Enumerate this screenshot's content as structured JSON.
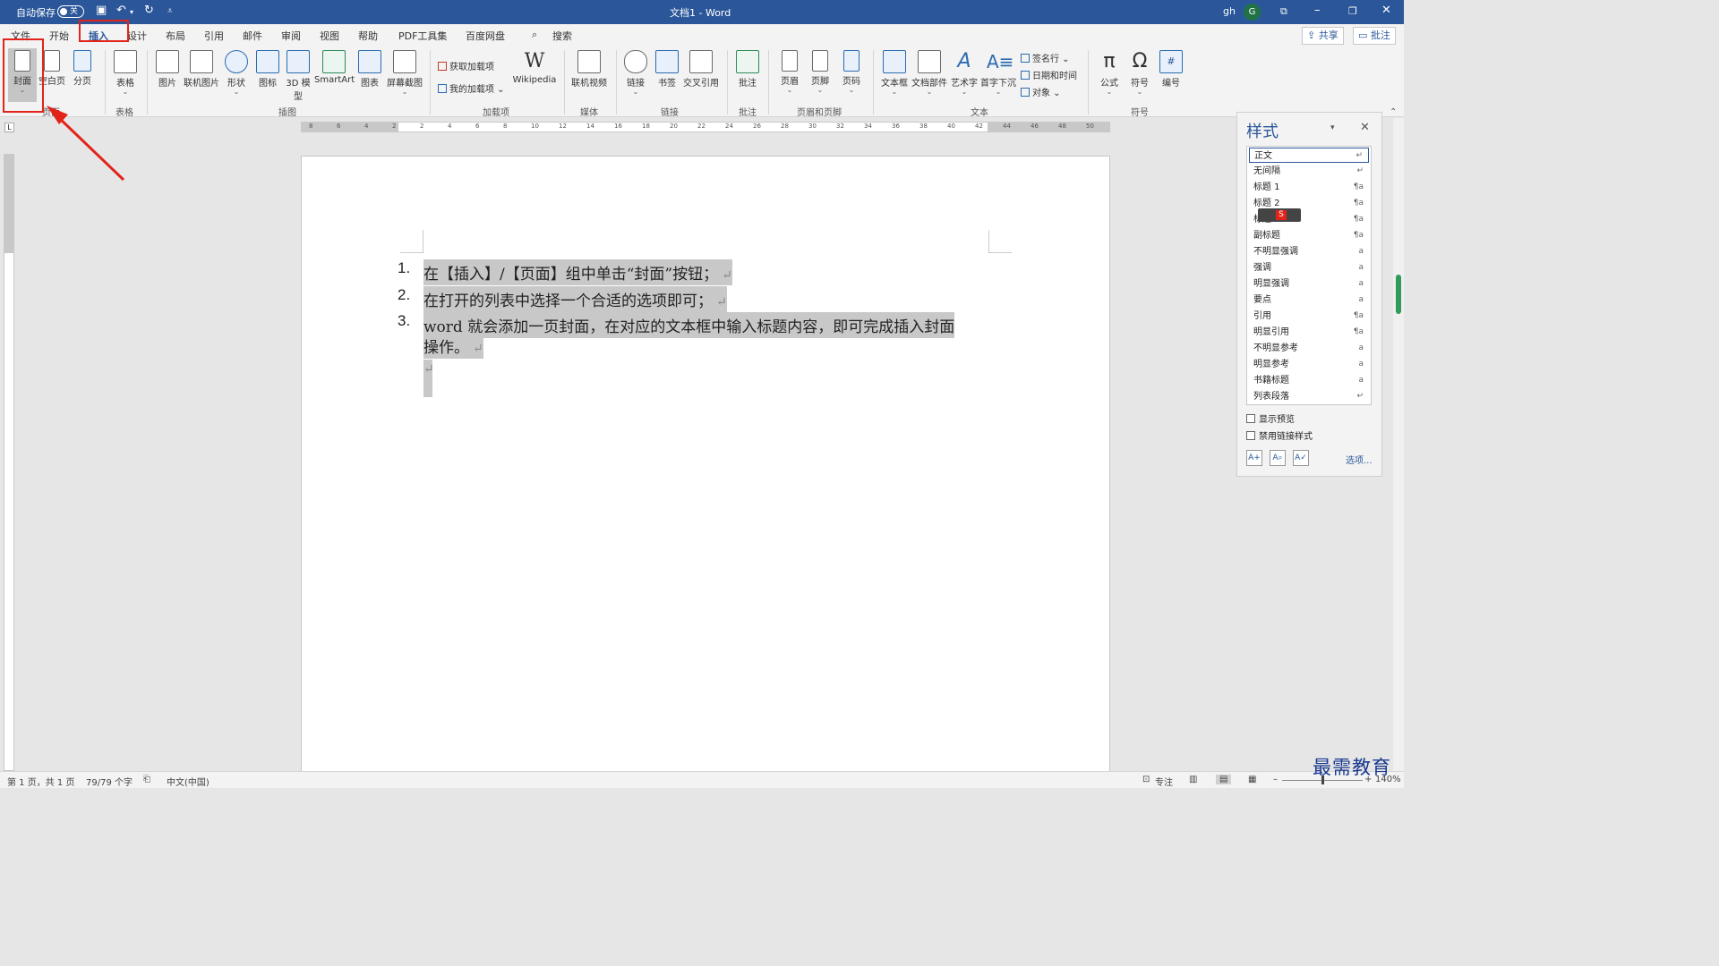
{
  "titlebar": {
    "autosave_label": "自动保存",
    "autosave_state": "关",
    "doc_title": "文档1 - Word",
    "user": "gh",
    "avatar_letter": "G"
  },
  "tabs": [
    "文件",
    "开始",
    "插入",
    "设计",
    "布局",
    "引用",
    "邮件",
    "审阅",
    "视图",
    "帮助",
    "PDF工具集",
    "百度网盘"
  ],
  "active_tab": "插入",
  "search_label": "搜索",
  "share_label": "共享",
  "comment_label": "批注",
  "ribbon": {
    "pages": {
      "group": "页面",
      "buttons": [
        "封面",
        "空白页",
        "分页"
      ]
    },
    "tables": {
      "group": "表格",
      "buttons": [
        "表格"
      ]
    },
    "illustrations": {
      "group": "插图",
      "buttons": [
        "图片",
        "联机图片",
        "形状",
        "图标",
        "3D 模型",
        "SmartArt",
        "图表",
        "屏幕截图"
      ]
    },
    "addins": {
      "group": "加载项",
      "get": "获取加载项",
      "mine": "我的加载项",
      "wiki": "Wikipedia"
    },
    "media": {
      "group": "媒体",
      "buttons": [
        "联机视频"
      ]
    },
    "links": {
      "group": "链接",
      "buttons": [
        "链接",
        "书签",
        "交叉引用"
      ]
    },
    "comments": {
      "group": "批注",
      "buttons": [
        "批注"
      ]
    },
    "header_footer": {
      "group": "页眉和页脚",
      "buttons": [
        "页眉",
        "页脚",
        "页码"
      ]
    },
    "text": {
      "group": "文本",
      "buttons": [
        "文本框",
        "文档部件",
        "艺术字",
        "首字下沉"
      ],
      "small": [
        "签名行",
        "日期和时间",
        "对象"
      ]
    },
    "symbols": {
      "group": "符号",
      "buttons": [
        "公式",
        "符号",
        "编号"
      ]
    }
  },
  "document": {
    "items": [
      {
        "num": "1.",
        "text": "在【插入】/【页面】组中单击“封面”按钮；"
      },
      {
        "num": "2.",
        "text": "在打开的列表中选择一个合适的选项即可；"
      },
      {
        "num": "3.",
        "text": "word 就会添加一页封面，在对应的文本框中输入标题内容，即可完成插入封面",
        "text2": "操作。"
      }
    ],
    "pilcrow": "↵"
  },
  "styles_pane": {
    "title": "样式",
    "items": [
      {
        "name": "正文",
        "mark": "↵"
      },
      {
        "name": "无间隔",
        "mark": "↵"
      },
      {
        "name": "标题 1",
        "mark": "¶a"
      },
      {
        "name": "标题 2",
        "mark": "¶a"
      },
      {
        "name": "标题",
        "mark": "¶a"
      },
      {
        "name": "副标题",
        "mark": "¶a"
      },
      {
        "name": "不明显强调",
        "mark": "a"
      },
      {
        "name": "强调",
        "mark": "a"
      },
      {
        "name": "明显强调",
        "mark": "a"
      },
      {
        "name": "要点",
        "mark": "a"
      },
      {
        "name": "引用",
        "mark": "¶a"
      },
      {
        "name": "明显引用",
        "mark": "¶a"
      },
      {
        "name": "不明显参考",
        "mark": "a"
      },
      {
        "name": "明显参考",
        "mark": "a"
      },
      {
        "name": "书籍标题",
        "mark": "a"
      },
      {
        "name": "列表段落",
        "mark": "↵"
      }
    ],
    "show_preview": "显示预览",
    "disable_linked": "禁用链接样式",
    "options": "选项..."
  },
  "ruler": {
    "h_ticks": [
      "8",
      "6",
      "4",
      "2",
      "2",
      "4",
      "6",
      "8",
      "10",
      "12",
      "14",
      "16",
      "18",
      "20",
      "22",
      "24",
      "26",
      "28",
      "30",
      "32",
      "34",
      "36",
      "38",
      "40",
      "42",
      "44",
      "46",
      "48",
      "50"
    ]
  },
  "status": {
    "page": "第 1 页，共 1 页",
    "words": "79/79 个字",
    "lang": "中文(中国)",
    "focus": "专注",
    "zoom": "140%"
  },
  "watermark": "最需教育",
  "colors": {
    "accent": "#2b579a",
    "annotation": "#e2231a"
  }
}
